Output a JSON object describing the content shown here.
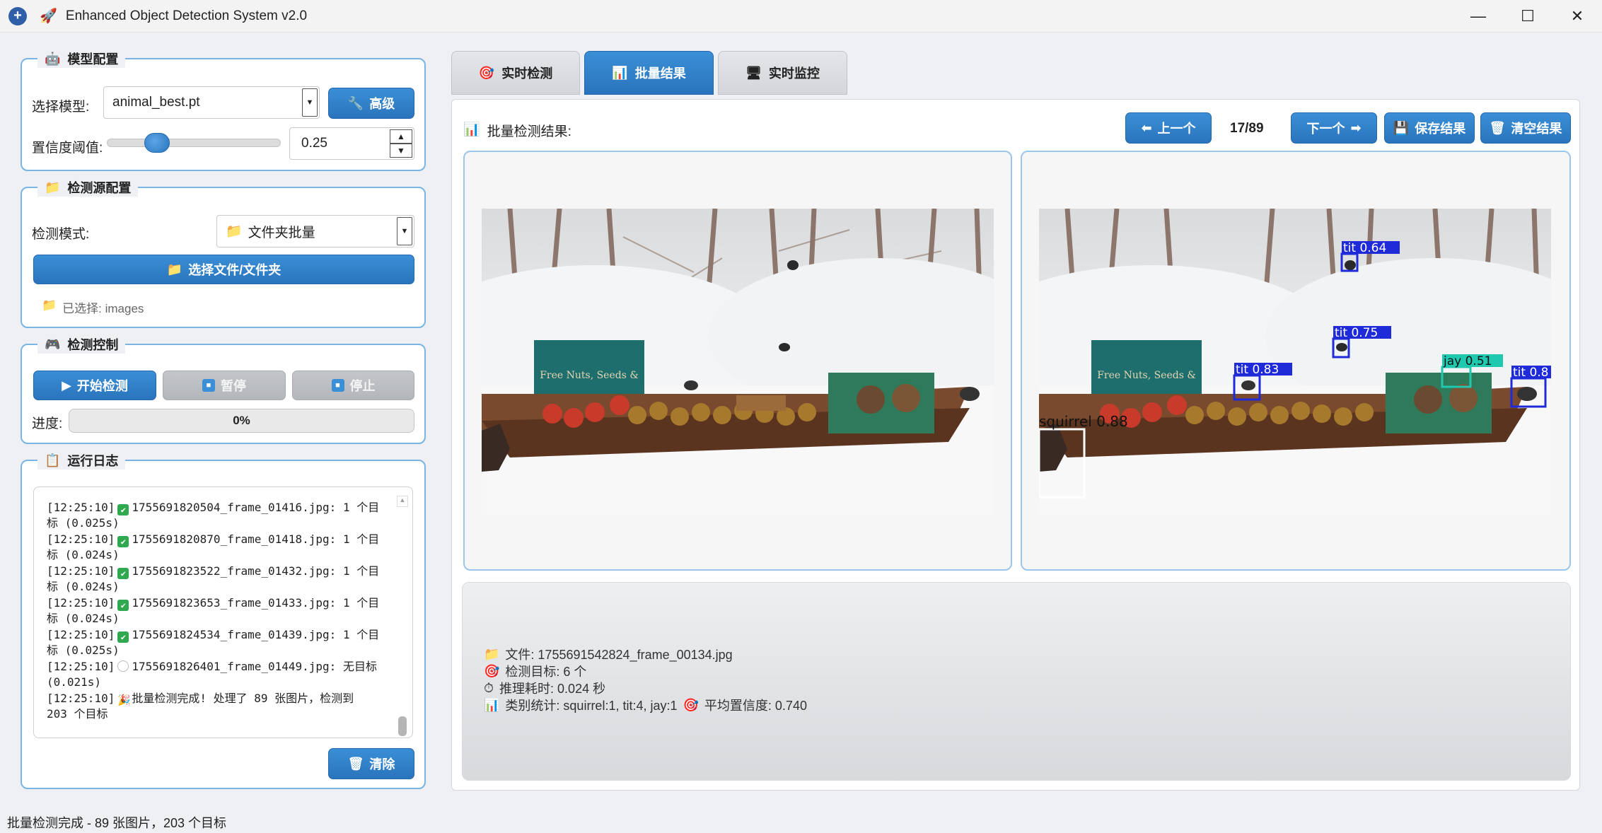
{
  "window": {
    "title": "Enhanced Object Detection System v2.0",
    "minimize": "—",
    "maximize": "☐",
    "close": "✕"
  },
  "model_config": {
    "title": "模型配置",
    "model_label": "选择模型:",
    "model_value": "animal_best.pt",
    "advanced_label": "高级",
    "conf_label": "置信度阈值:",
    "conf_value": "0.25",
    "conf_slider_fraction": 0.25
  },
  "source_config": {
    "title": "检测源配置",
    "mode_label": "检测模式:",
    "mode_value": "文件夹批量",
    "select_button": "选择文件/文件夹",
    "selected_text": "已选择: images"
  },
  "detect_control": {
    "title": "检测控制",
    "start_label": "开始检测",
    "pause_label": "暂停",
    "stop_label": "停止",
    "progress_label": "进度:",
    "progress_text": "0%",
    "progress_fraction": 0
  },
  "run_log": {
    "title": "运行日志",
    "clear_label": "清除",
    "entries": [
      {
        "time": "[12:25:10]",
        "status": "ok",
        "line1": "1755691820504_frame_01416.jpg: 1 个目",
        "line2": "标 (0.025s)"
      },
      {
        "time": "[12:25:10]",
        "status": "ok",
        "line1": "1755691820870_frame_01418.jpg: 1 个目",
        "line2": "标 (0.024s)"
      },
      {
        "time": "[12:25:10]",
        "status": "ok",
        "line1": "1755691823522_frame_01432.jpg: 1 个目",
        "line2": "标 (0.024s)"
      },
      {
        "time": "[12:25:10]",
        "status": "ok",
        "line1": "1755691823653_frame_01433.jpg: 1 个目",
        "line2": "标 (0.024s)"
      },
      {
        "time": "[12:25:10]",
        "status": "ok",
        "line1": "1755691824534_frame_01439.jpg: 1 个目",
        "line2": "标 (0.025s)"
      },
      {
        "time": "[12:25:10]",
        "status": "none",
        "line1": "1755691826401_frame_01449.jpg: 无目标",
        "line2": "(0.021s)"
      },
      {
        "time": "[12:25:10]",
        "status": "party",
        "line1": "批量检测完成! 处理了 89 张图片，检测到",
        "line2": "203 个目标"
      }
    ]
  },
  "tabs": [
    {
      "label": "实时检测",
      "icon": "target-icon"
    },
    {
      "label": "批量结果",
      "icon": "bar-chart-icon"
    },
    {
      "label": "实时监控",
      "icon": "monitor-icon"
    }
  ],
  "batch": {
    "header_label": "批量检测结果:",
    "prev_label": "上一个",
    "page_indicator": "17/89",
    "next_label": "下一个",
    "save_label": "保存结果",
    "clear_label": "清空结果"
  },
  "detections": [
    {
      "label": "squirrel 0.88",
      "color": "#ffffff"
    },
    {
      "label": "tit 0.64",
      "color": "#1f2bd8"
    },
    {
      "label": "tit 0.75",
      "color": "#1f2bd8"
    },
    {
      "label": "tit 0.83",
      "color": "#1f2bd8"
    },
    {
      "label": "jay 0.51",
      "color": "#1ec9b0"
    },
    {
      "label": "tit 0.8",
      "color": "#1f2bd8"
    }
  ],
  "info": {
    "file": "文件: 1755691542824_frame_00134.jpg",
    "targets": "检测目标: 6 个",
    "time": "推理耗时: 0.024 秒",
    "stats": "类别统计: squirrel:1, tit:4, jay:1",
    "avg_conf": "平均置信度: 0.740"
  },
  "status_bar": "批量检测完成 - 89 张图片，203 个目标",
  "colors": {
    "accent": "#2a74bd",
    "border": "#78b4e4",
    "ok": "#2fa84f"
  }
}
